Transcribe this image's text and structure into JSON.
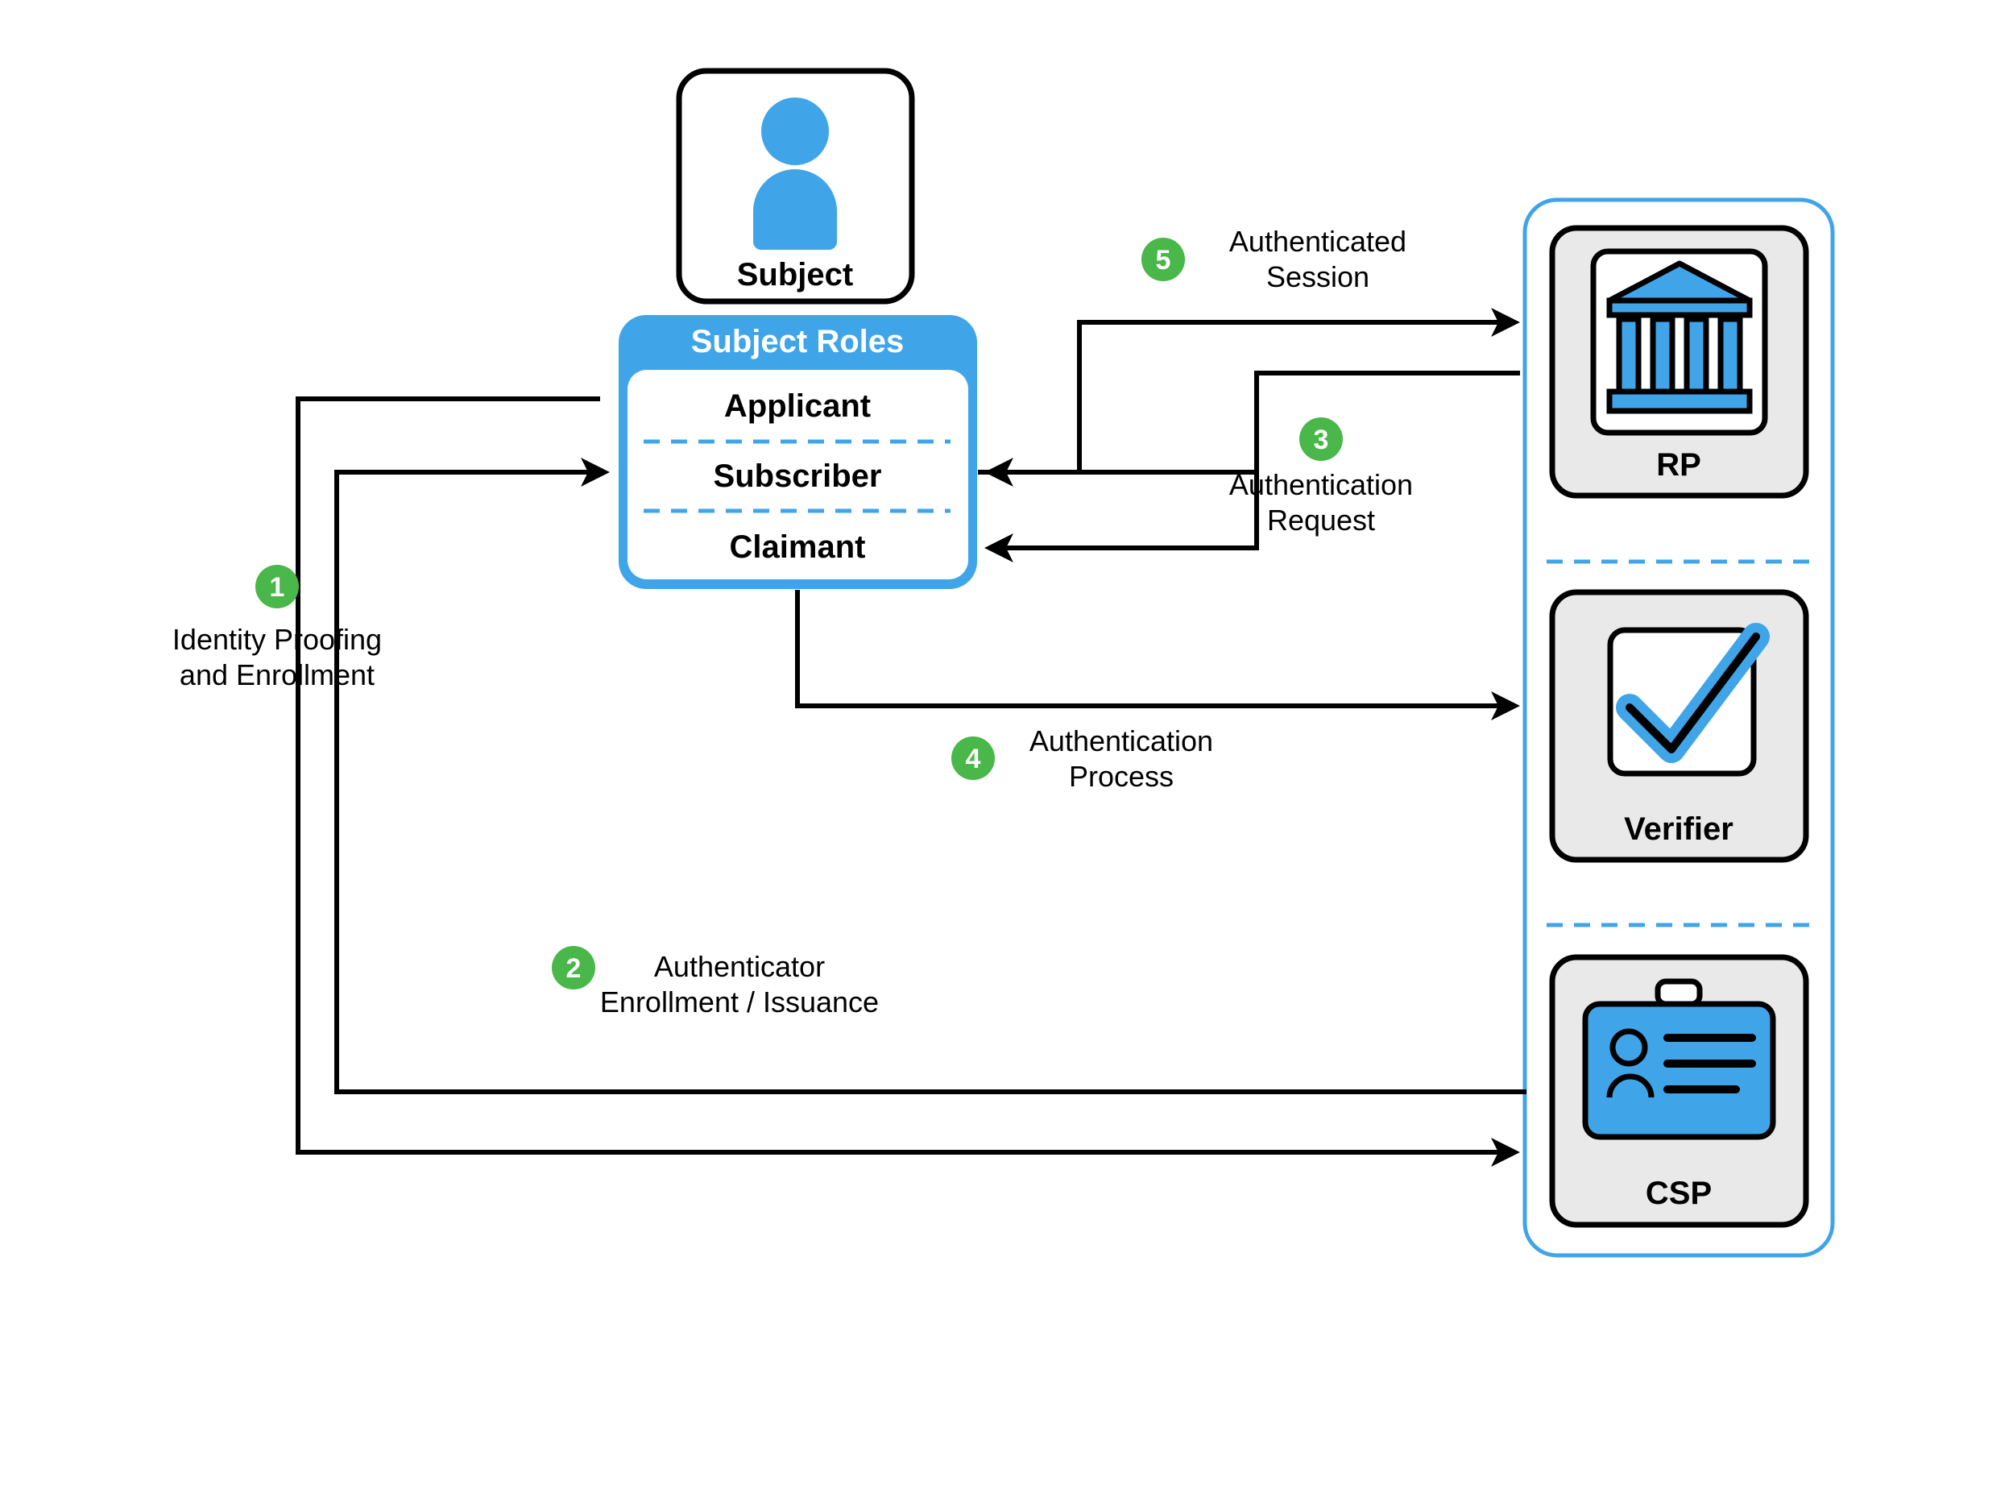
{
  "colors": {
    "blue": "#3fa5e8",
    "green": "#49b749",
    "grey": "#e9e9e9",
    "black": "#000"
  },
  "subject": {
    "label": "Subject"
  },
  "subjectRoles": {
    "header": "Subject Roles",
    "items": [
      "Applicant",
      "Subscriber",
      "Claimant"
    ]
  },
  "entities": {
    "rp": "RP",
    "verifier": "Verifier",
    "csp": "CSP"
  },
  "steps": {
    "1": {
      "num": "1",
      "line1": "Identity Proofing",
      "line2": "and Enrollment"
    },
    "2": {
      "num": "2",
      "line1": "Authenticator",
      "line2": "Enrollment / Issuance"
    },
    "3": {
      "num": "3",
      "line1": "Authentication",
      "line2": "Request"
    },
    "4": {
      "num": "4",
      "line1": "Authentication",
      "line2": "Process"
    },
    "5": {
      "num": "5",
      "line1": "Authenticated",
      "line2": "Session"
    }
  }
}
